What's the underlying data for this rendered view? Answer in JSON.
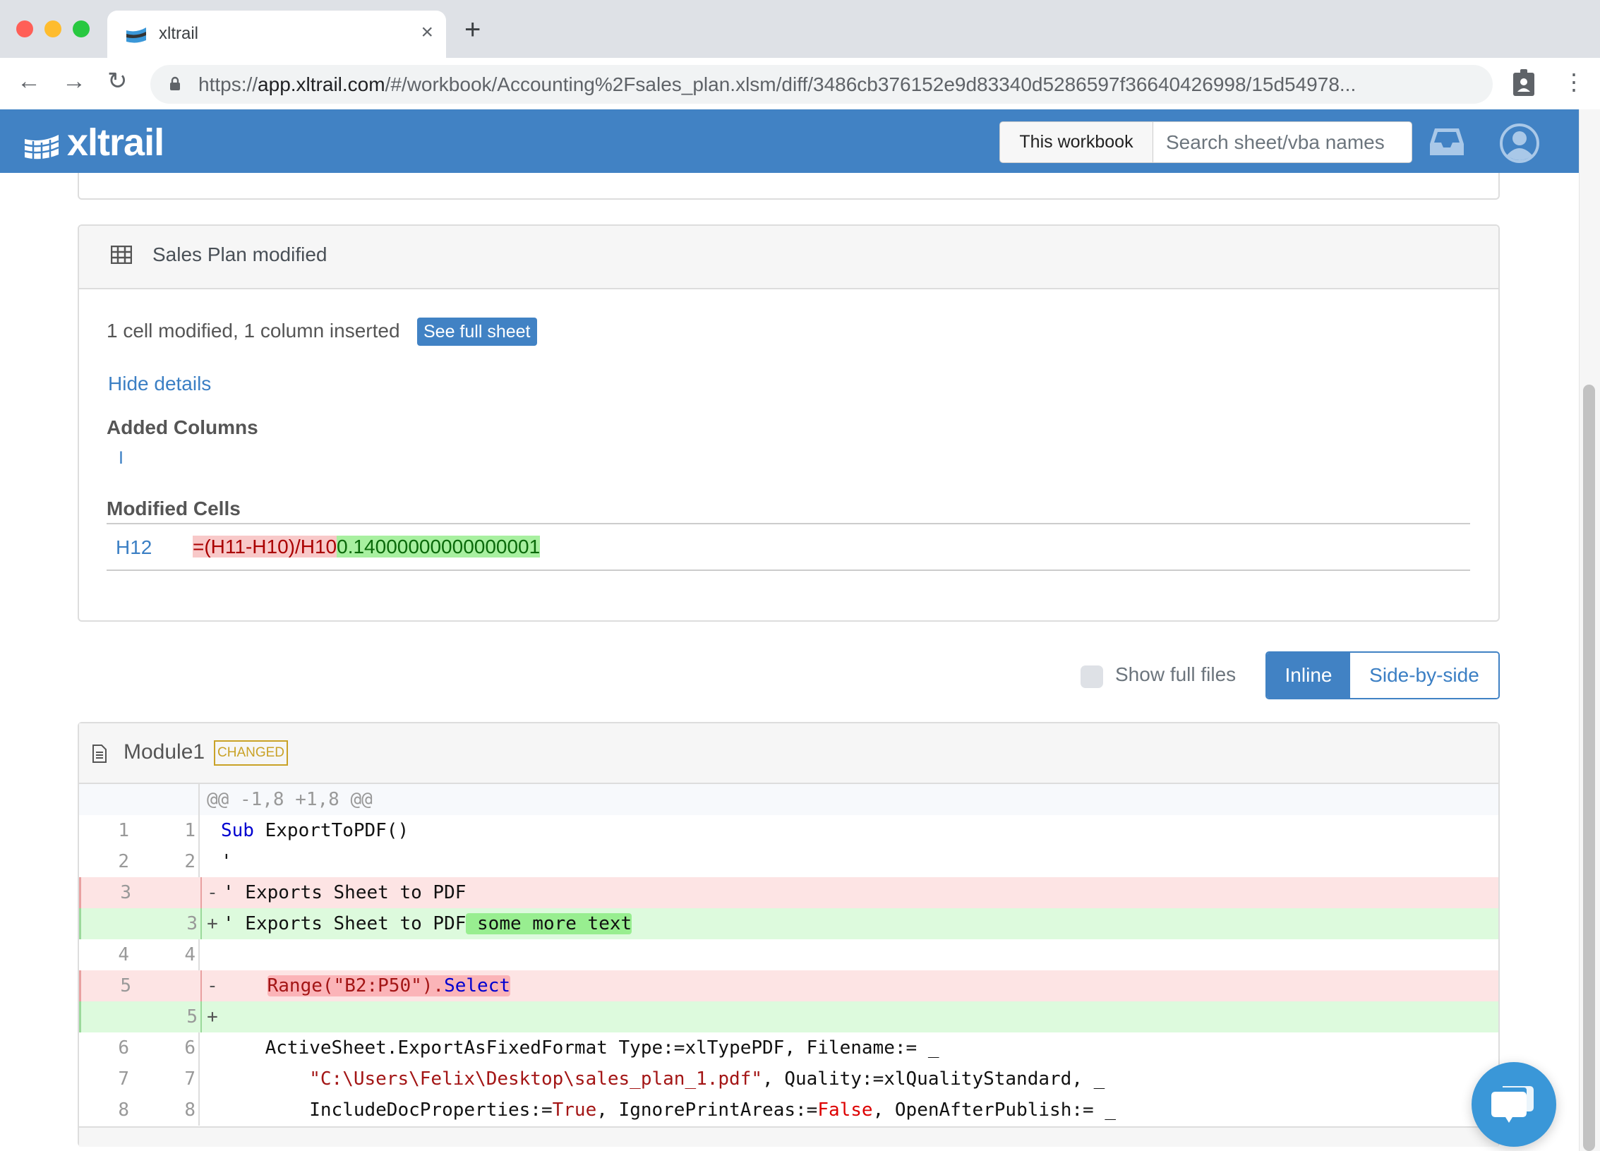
{
  "browser": {
    "tab_title": "xltrail",
    "tab_close_icon": "close-icon",
    "new_tab_icon": "plus-icon",
    "url_prefix": "https://",
    "url_host": "app.xltrail.com",
    "url_path": "/#/workbook/Accounting%2Fsales_plan.xlsm/diff/3486cb376152e9d83340d5286597f36640426998/15d54978..."
  },
  "header": {
    "logo_text": "xltrail",
    "scope_label": "This workbook",
    "search_placeholder": "Search sheet/vba names"
  },
  "sheet_change": {
    "title": "Sales Plan modified",
    "summary": "1 cell modified, 1 column inserted",
    "see_full_sheet": "See full sheet",
    "hide_details": "Hide details",
    "added_columns_heading": "Added Columns",
    "added_columns": [
      "I"
    ],
    "modified_cells_heading": "Modified Cells",
    "modified_cells": [
      {
        "cell": "H12",
        "old": "=(H11-H10)/H10",
        "new": "0.14000000000000001"
      }
    ]
  },
  "view_options": {
    "show_full_files": "Show full files",
    "show_full_files_checked": false,
    "inline": "Inline",
    "side_by_side": "Side-by-side",
    "active": "Inline"
  },
  "module": {
    "name": "Module1",
    "badge": "CHANGED",
    "hunk_header": "@@ -1,8 +1,8 @@",
    "lines": [
      {
        "type": "ctx",
        "old": "1",
        "new": "1"
      },
      {
        "type": "ctx",
        "old": "2",
        "new": "2"
      },
      {
        "type": "del",
        "old": "3",
        "new": "",
        "sign": "-"
      },
      {
        "type": "add",
        "old": "",
        "new": "3",
        "sign": "+"
      },
      {
        "type": "ctx",
        "old": "4",
        "new": "4"
      },
      {
        "type": "del",
        "old": "5",
        "new": "",
        "sign": "-"
      },
      {
        "type": "add",
        "old": "",
        "new": "5",
        "sign": "+"
      },
      {
        "type": "ctx",
        "old": "6",
        "new": "6"
      },
      {
        "type": "ctx",
        "old": "7",
        "new": "7"
      },
      {
        "type": "ctx",
        "old": "8",
        "new": "8"
      }
    ],
    "code": {
      "l1_kw": "Sub",
      "l1_rest": " ExportToPDF()",
      "l2": "'",
      "l3": "' Exports Sheet to PDF",
      "l3_add_base": "' Exports Sheet to PDF",
      "l3_add_extra": " some more text",
      "l5_del_a": "Range(\"B2:P50\").",
      "l5_del_b": "Select",
      "l6": "ActiveSheet.ExportAsFixedFormat Type:=xlTypePDF, Filename:= _",
      "l7_str": "\"C:\\Users\\Felix\\Desktop\\sales_plan_1.pdf\"",
      "l7_rest": ", Quality:=xlQualityStandard, _",
      "l8_a": "IncludeDocProperties:=",
      "l8_true": "True",
      "l8_b": ", IgnorePrintAreas:=",
      "l8_false": "False",
      "l8_c": ", OpenAfterPublish:= _"
    }
  },
  "colors": {
    "brand_blue": "#4182c4",
    "link_blue": "#3b7fc4",
    "badge_gold": "#c9a227",
    "diff_del_bg": "#fde4e4",
    "diff_add_bg": "#ddfadd",
    "chat_blue": "#3a97d8"
  }
}
